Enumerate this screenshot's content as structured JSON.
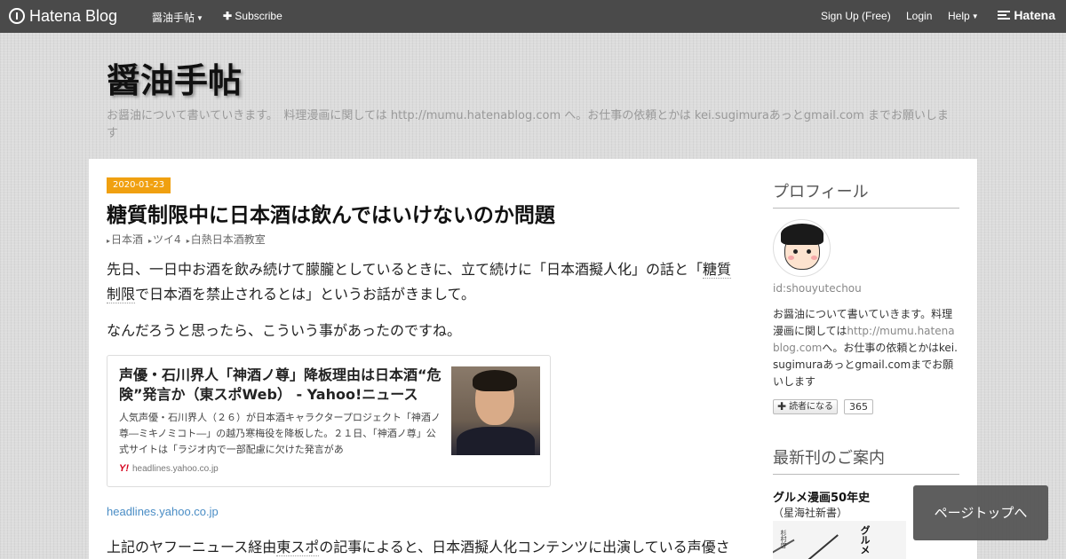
{
  "topbar": {
    "logo_text": "Hatena Blog",
    "blog_menu": "醤油手帖",
    "subscribe": "Subscribe",
    "signup": "Sign Up (Free)",
    "login": "Login",
    "help": "Help",
    "brand": "Hatena"
  },
  "header": {
    "title": "醤油手帖",
    "description": "お醤油について書いていきます。　料理漫画に関しては http://mumu.hatenablog.com へ。お仕事の依頼とかは kei.sugimuraあっとgmail.com までお願いします"
  },
  "entry": {
    "date": "2020-01-23",
    "title": "糖質制限中に日本酒は飲んではいけないのか問題",
    "categories": [
      "日本酒",
      "ツイ4",
      "白熱日本酒教室"
    ],
    "para1_pre": "先日、一日中お酒を飲み続けて朦朧としているときに、立て続けに「日本酒擬人化」の話と「",
    "para1_keyword": "糖質制限",
    "para1_post": "で日本酒を禁止されるとは」というお話がきまして。",
    "para2": "なんだろうと思ったら、こういう事があったのですね。",
    "embed": {
      "title": "声優・石川界人「神酒ノ尊」降板理由は日本酒“危険”発言か（東スポWeb） - Yahoo!ニュース",
      "desc": "人気声優・石川界人（２６）が日本酒キャラクタープロジェクト「神酒ノ尊―ミキノミコト―」の越乃寒梅役を降板した。２１日、「神酒ノ尊」公式サイトは「ラジオ内で一部配慮に欠けた発言があ",
      "source_icon": "Y!",
      "source": "headlines.yahoo.co.jp"
    },
    "source_link": "headlines.yahoo.co.jp",
    "para3_pre": "上記のヤフーニュース経由",
    "para3_keyword": "東スポ",
    "para3_post": "の記事によると、日本酒擬人化コンテンツに出演している声優さ"
  },
  "sidebar": {
    "profile_heading": "プロフィール",
    "profile_id": "id:shouyutechou",
    "profile_desc_1": "お醤油について書いていきます。料理漫画に関しては",
    "profile_url": "http://mumu.hatenablog.com",
    "profile_desc_2": "へ。お仕事の依頼とかは",
    "profile_email": "kei.sugimura",
    "profile_desc_3": "あっとgmail.comまでお願いします",
    "reader_button": "読者になる",
    "reader_count": "365",
    "books_heading": "最新刊のご案内",
    "book_title": "グルメ漫画50年史",
    "book_subtitle": "（星海社新書）",
    "book_cover_author": "杉村啓",
    "book_cover_title": "グルメ"
  },
  "pagetop": "ページトップへ"
}
